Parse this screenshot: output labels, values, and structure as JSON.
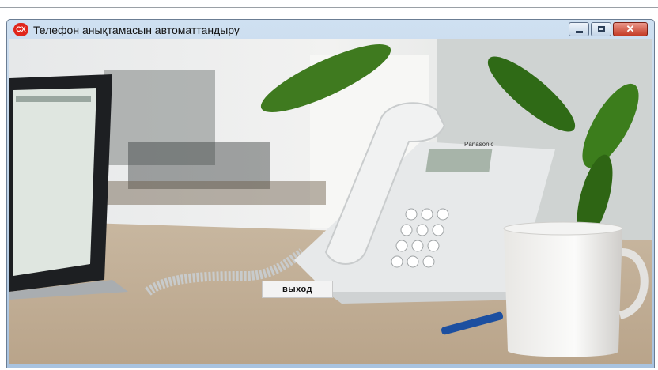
{
  "window": {
    "app_icon_text": "CX",
    "title": "Телефон анықтамасын автоматтандыру",
    "controls": {
      "minimize": "minimize-icon",
      "maximize": "maximize-icon",
      "close": "close-icon"
    }
  },
  "scene": {
    "phone_brand": "Panasonic"
  },
  "exit_button": {
    "label": "выход"
  }
}
